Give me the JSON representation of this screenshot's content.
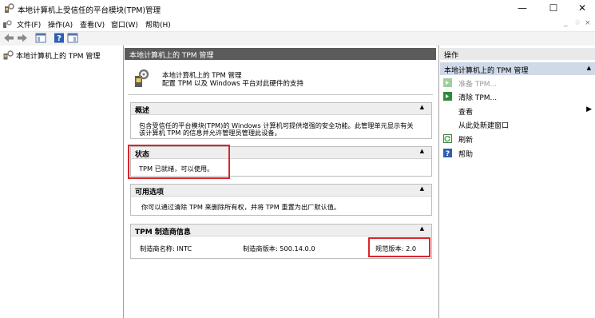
{
  "window": {
    "title": "本地计算机上受信任的平台模块(TPM)管理",
    "minimize": "—",
    "maximize": "☐",
    "close": "✕"
  },
  "menu": {
    "items": [
      "文件(F)",
      "操作(A)",
      "查看(V)",
      "窗口(W)",
      "帮助(H)"
    ],
    "mdi": [
      "_",
      "♢",
      "×"
    ]
  },
  "tree": {
    "root_label": "本地计算机上的 TPM 管理"
  },
  "center": {
    "header": "本地计算机上的 TPM 管理",
    "info_title": "本地计算机上的 TPM 管理",
    "info_desc": "配置 TPM 以及 Windows 平台对此硬件的支持",
    "overview": {
      "title": "概述",
      "line1": "包含受信任的平台模块(TPM)的 Windows 计算机可提供增强的安全功能。此管理单元显示有关",
      "line2": "该计算机 TPM 的信息并允许管理员管理此设备。"
    },
    "status": {
      "title": "状态",
      "text": "TPM 已就绪，可以使用。"
    },
    "options": {
      "title": "可用选项",
      "text": "你可以通过清除 TPM 来删除所有权，并将 TPM 重置为出厂默认值。"
    },
    "manufacturer": {
      "title": "TPM 制造商信息",
      "name_label": "制造商名称: INTC",
      "version_label": "制造商版本: 500.14.0.0",
      "spec_label": "规范版本: 2.0"
    }
  },
  "actions": {
    "header": "操作",
    "group": "本地计算机上的 TPM 管理",
    "items": [
      {
        "label": "准备 TPM...",
        "disabled": true
      },
      {
        "label": "清除 TPM...",
        "disabled": false
      },
      {
        "label": "查看",
        "disabled": false
      },
      {
        "label": "从此处新建窗口",
        "disabled": false
      },
      {
        "label": "刷新",
        "disabled": false
      },
      {
        "label": "帮助",
        "disabled": false
      }
    ]
  },
  "colors": {
    "highlight": "#d9262c",
    "header_dark": "#5b5b5b",
    "action_group": "#cfd9e8"
  }
}
